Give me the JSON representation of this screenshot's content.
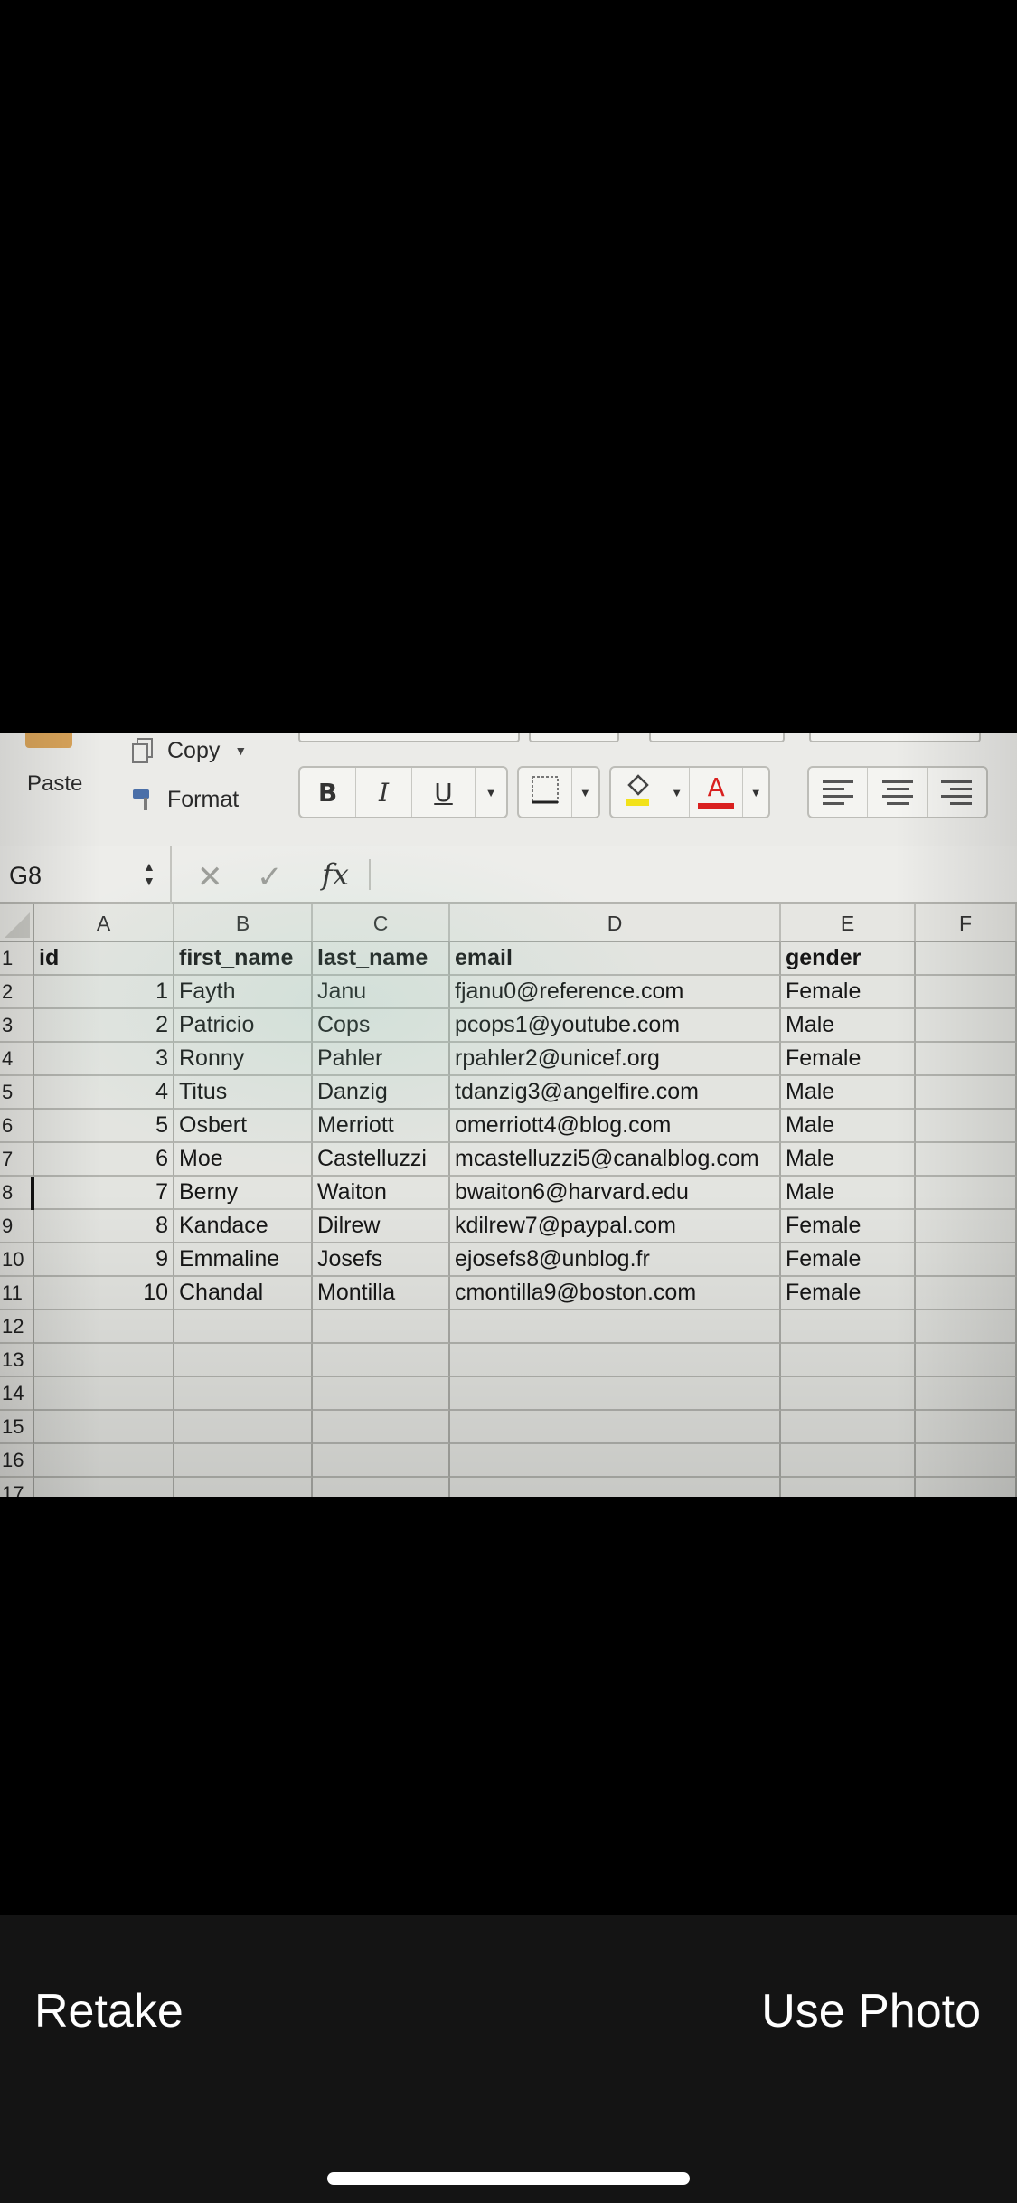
{
  "spreadsheet": {
    "ribbon": {
      "paste_label": "Paste",
      "copy_label": "Copy",
      "format_label": "Format",
      "bold_label": "B",
      "italic_label": "I",
      "underline_label": "U",
      "font_color_label": "A",
      "font_color": "#d9201f",
      "fill_color": "#f2e21a"
    },
    "formula_bar": {
      "name_box": "G8",
      "fx_label": "fx",
      "formula": ""
    },
    "columns": [
      "A",
      "B",
      "C",
      "D",
      "E",
      "F"
    ],
    "row_numbers": [
      "1",
      "2",
      "3",
      "4",
      "5",
      "6",
      "7",
      "8",
      "9",
      "10",
      "11",
      "12",
      "13",
      "14",
      "15",
      "16",
      "17"
    ],
    "header": {
      "id": "id",
      "first_name": "first_name",
      "last_name": "last_name",
      "email": "email",
      "gender": "gender"
    },
    "rows": [
      {
        "id": "1",
        "first_name": "Fayth",
        "last_name": "Janu",
        "email": "fjanu0@reference.com",
        "gender": "Female"
      },
      {
        "id": "2",
        "first_name": "Patricio",
        "last_name": "Cops",
        "email": "pcops1@youtube.com",
        "gender": "Male"
      },
      {
        "id": "3",
        "first_name": "Ronny",
        "last_name": "Pahler",
        "email": "rpahler2@unicef.org",
        "gender": "Female"
      },
      {
        "id": "4",
        "first_name": "Titus",
        "last_name": "Danzig",
        "email": "tdanzig3@angelfire.com",
        "gender": "Male"
      },
      {
        "id": "5",
        "first_name": "Osbert",
        "last_name": "Merriott",
        "email": "omerriott4@blog.com",
        "gender": "Male"
      },
      {
        "id": "6",
        "first_name": "Moe",
        "last_name": "Castelluzzi",
        "email": "mcastelluzzi5@canalblog.com",
        "gender": "Male"
      },
      {
        "id": "7",
        "first_name": "Berny",
        "last_name": "Waiton",
        "email": "bwaiton6@harvard.edu",
        "gender": "Male"
      },
      {
        "id": "8",
        "first_name": "Kandace",
        "last_name": "Dilrew",
        "email": "kdilrew7@paypal.com",
        "gender": "Female"
      },
      {
        "id": "9",
        "first_name": "Emmaline",
        "last_name": "Josefs",
        "email": "ejosefs8@unblog.fr",
        "gender": "Female"
      },
      {
        "id": "10",
        "first_name": "Chandal",
        "last_name": "Montilla",
        "email": "cmontilla9@boston.com",
        "gender": "Female"
      }
    ]
  },
  "camera": {
    "retake_label": "Retake",
    "use_photo_label": "Use Photo"
  }
}
